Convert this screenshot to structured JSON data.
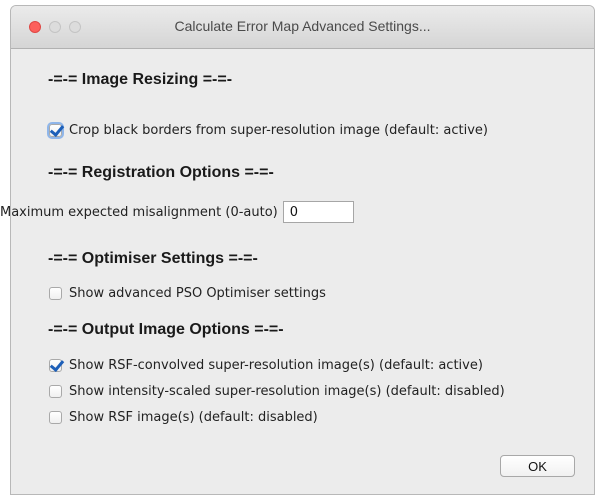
{
  "window": {
    "title": "Calculate Error Map Advanced Settings..."
  },
  "sections": {
    "image_resizing": "-=-= Image Resizing =-=-",
    "registration": "-=-= Registration Options =-=-",
    "optimiser": "-=-= Optimiser Settings =-=-",
    "output": "-=-= Output Image Options =-=-"
  },
  "options": {
    "crop_borders": {
      "label": "Crop black borders from super-resolution image (default: active)",
      "checked": true
    },
    "advanced_pso": {
      "label": "Show advanced PSO Optimiser settings",
      "checked": false
    },
    "rsf_convolved": {
      "label": "Show RSF-convolved super-resolution image(s) (default: active)",
      "checked": true
    },
    "intensity_scaled": {
      "label": "Show intensity-scaled super-resolution image(s) (default: disabled)",
      "checked": false
    },
    "rsf_images": {
      "label": "Show RSF image(s) (default: disabled)",
      "checked": false
    }
  },
  "misalignment": {
    "label": "Maximum expected misalignment (0-auto)",
    "value": "0"
  },
  "buttons": {
    "ok": "OK"
  }
}
